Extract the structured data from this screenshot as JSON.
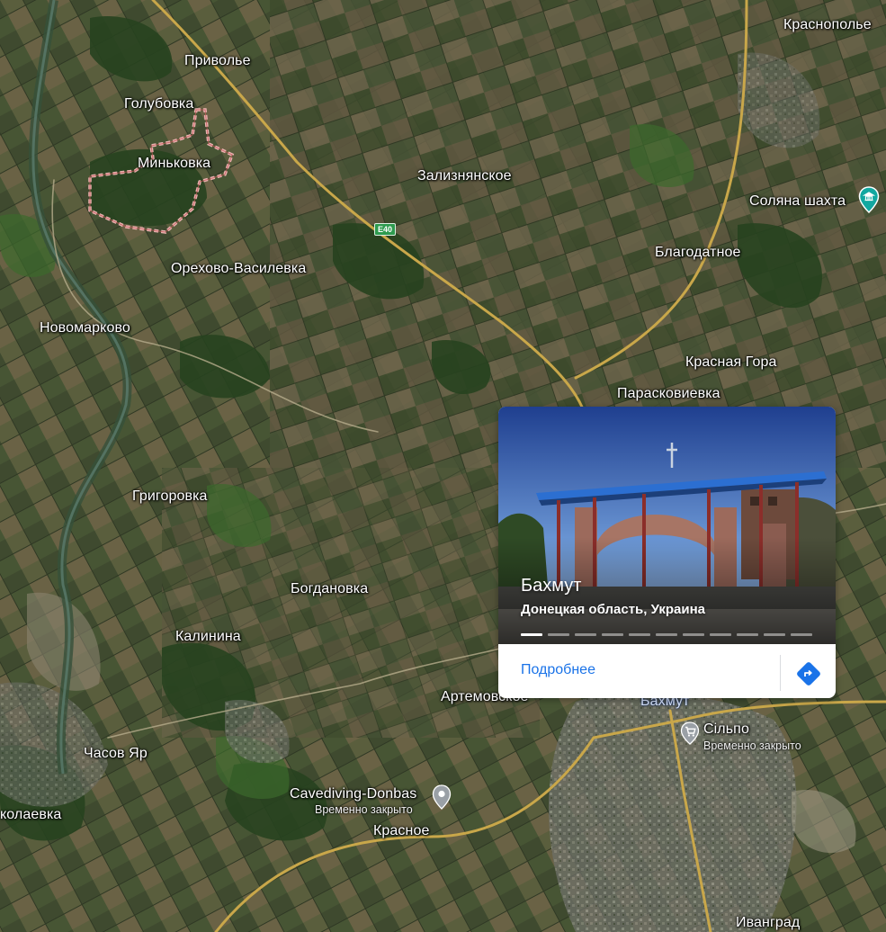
{
  "map": {
    "type": "satellite",
    "colors": {
      "label": "#ffffff",
      "road": "#e8c860",
      "boundary": "#e8a0a0",
      "poi": "#9aa0a6",
      "accent": "#1a73e8"
    },
    "labels": {
      "krasnopolye": "Краснополье",
      "privolye": "Приволье",
      "golubovka": "Голубовка",
      "minkovka": "Миньковка",
      "zaliznyanskoe": "Зализнянское",
      "solyana": "Соляна шахта",
      "blagodatnoe": "Благодатное",
      "orekhovo": "Орехово-Василевка",
      "novomarkovo": "Новомарково",
      "krasnaya_gora": "Красная Гора",
      "paraskovievka": "Парасковиевка",
      "grigorovka": "Григоровка",
      "bogdanovka": "Богдановка",
      "kalinina": "Калинина",
      "artemovskoe": "Артемовское",
      "bakhmut": "Бахмут",
      "chasov_yar": "Часов Яр",
      "nikolaevka": "колаевка",
      "krasnoe": "Красное",
      "ivangrad": "Ивангрaд"
    },
    "road_badge": "E40",
    "pois": {
      "cavediving_name": "Cavediving-Donbas",
      "cavediving_status": "Временно закрыто",
      "silpo_name": "Сільпо",
      "silpo_status": "Временно закрыто"
    },
    "icons": {
      "solyana": "museum-icon",
      "silpo": "shopping-cart-icon",
      "cavediving": "pin-icon"
    }
  },
  "place_card": {
    "title": "Бахмут",
    "subtitle": "Донецкая область, Украина",
    "details_label": "Подробнее",
    "photo_count": 11,
    "active_photo": 1,
    "icons": {
      "directions": "directions-icon"
    }
  }
}
